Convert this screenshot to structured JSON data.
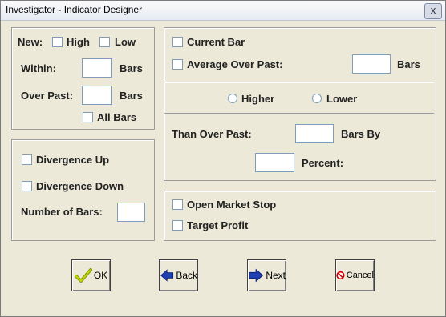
{
  "window": {
    "title": "Investigator - Indicator Designer",
    "close_glyph": "x"
  },
  "left_top": {
    "new_label": "New:",
    "high_label": "High",
    "low_label": "Low",
    "within_label": "Within:",
    "within_value": "",
    "within_unit": "Bars",
    "over_past_label": "Over Past:",
    "over_past_value": "",
    "over_past_unit": "Bars",
    "all_bars_label": "All Bars"
  },
  "left_bottom": {
    "divergence_up_label": "Divergence Up",
    "divergence_down_label": "Divergence Down",
    "number_of_bars_label": "Number of Bars:",
    "number_of_bars_value": ""
  },
  "right_top": {
    "current_bar_label": "Current Bar",
    "average_over_past_label": "Average Over Past:",
    "average_value": "",
    "average_unit": "Bars",
    "higher_label": "Higher",
    "lower_label": "Lower",
    "than_over_past_label": "Than Over Past:",
    "than_over_past_value": "",
    "bars_by_label": "Bars By",
    "percent_value": "",
    "percent_label": "Percent:"
  },
  "right_bottom": {
    "open_market_stop_label": "Open Market Stop",
    "target_profit_label": "Target Profit"
  },
  "buttons": {
    "ok_label": "OK",
    "back_label": "Back",
    "next_label": "Next",
    "cancel_label": "Cancel"
  },
  "icons": {
    "ok": "checkmark-icon",
    "back": "arrow-left-icon",
    "next": "arrow-right-icon",
    "cancel": "no-symbol-icon"
  }
}
